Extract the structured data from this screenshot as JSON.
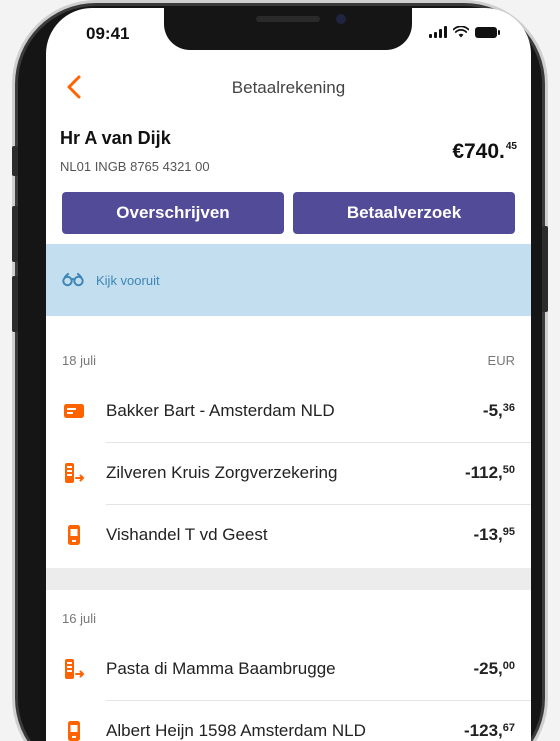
{
  "status_bar": {
    "time": "09:41"
  },
  "nav": {
    "title": "Betaalrekening"
  },
  "account": {
    "holder": "Hr A van Dijk",
    "iban": "NL01 INGB 8765 4321 00",
    "balance_main": "€740.",
    "balance_cents": "45"
  },
  "actions": {
    "transfer_label": "Overschrijven",
    "request_label": "Betaalverzoek"
  },
  "lookahead": {
    "label": "Kijk vooruit"
  },
  "sections": [
    {
      "date": "18 juli",
      "currency": "EUR",
      "transactions": [
        {
          "icon": "card-icon",
          "name": "Bakker Bart - Amsterdam NLD",
          "amount_main": "-5,",
          "amount_cents": "36"
        },
        {
          "icon": "transfer-out-icon",
          "name": "Zilveren Kruis Zorgverzekering",
          "amount_main": "-112,",
          "amount_cents": "50"
        },
        {
          "icon": "phone-pay-icon",
          "name": "Vishandel T vd Geest",
          "amount_main": "-13,",
          "amount_cents": "95"
        }
      ]
    },
    {
      "date": "16 juli",
      "transactions": [
        {
          "icon": "transfer-out-icon",
          "name": "Pasta di Mamma Baambrugge",
          "amount_main": "-25,",
          "amount_cents": "00"
        },
        {
          "icon": "phone-pay-icon",
          "name": "Albert Heijn 1598 Amsterdam NLD",
          "amount_main": "-123,",
          "amount_cents": "67"
        }
      ]
    }
  ],
  "colors": {
    "accent_orange": "#ff6200",
    "button_purple": "#524b97",
    "lookahead_bg": "#c3deef",
    "lookahead_text": "#3d86b6"
  }
}
